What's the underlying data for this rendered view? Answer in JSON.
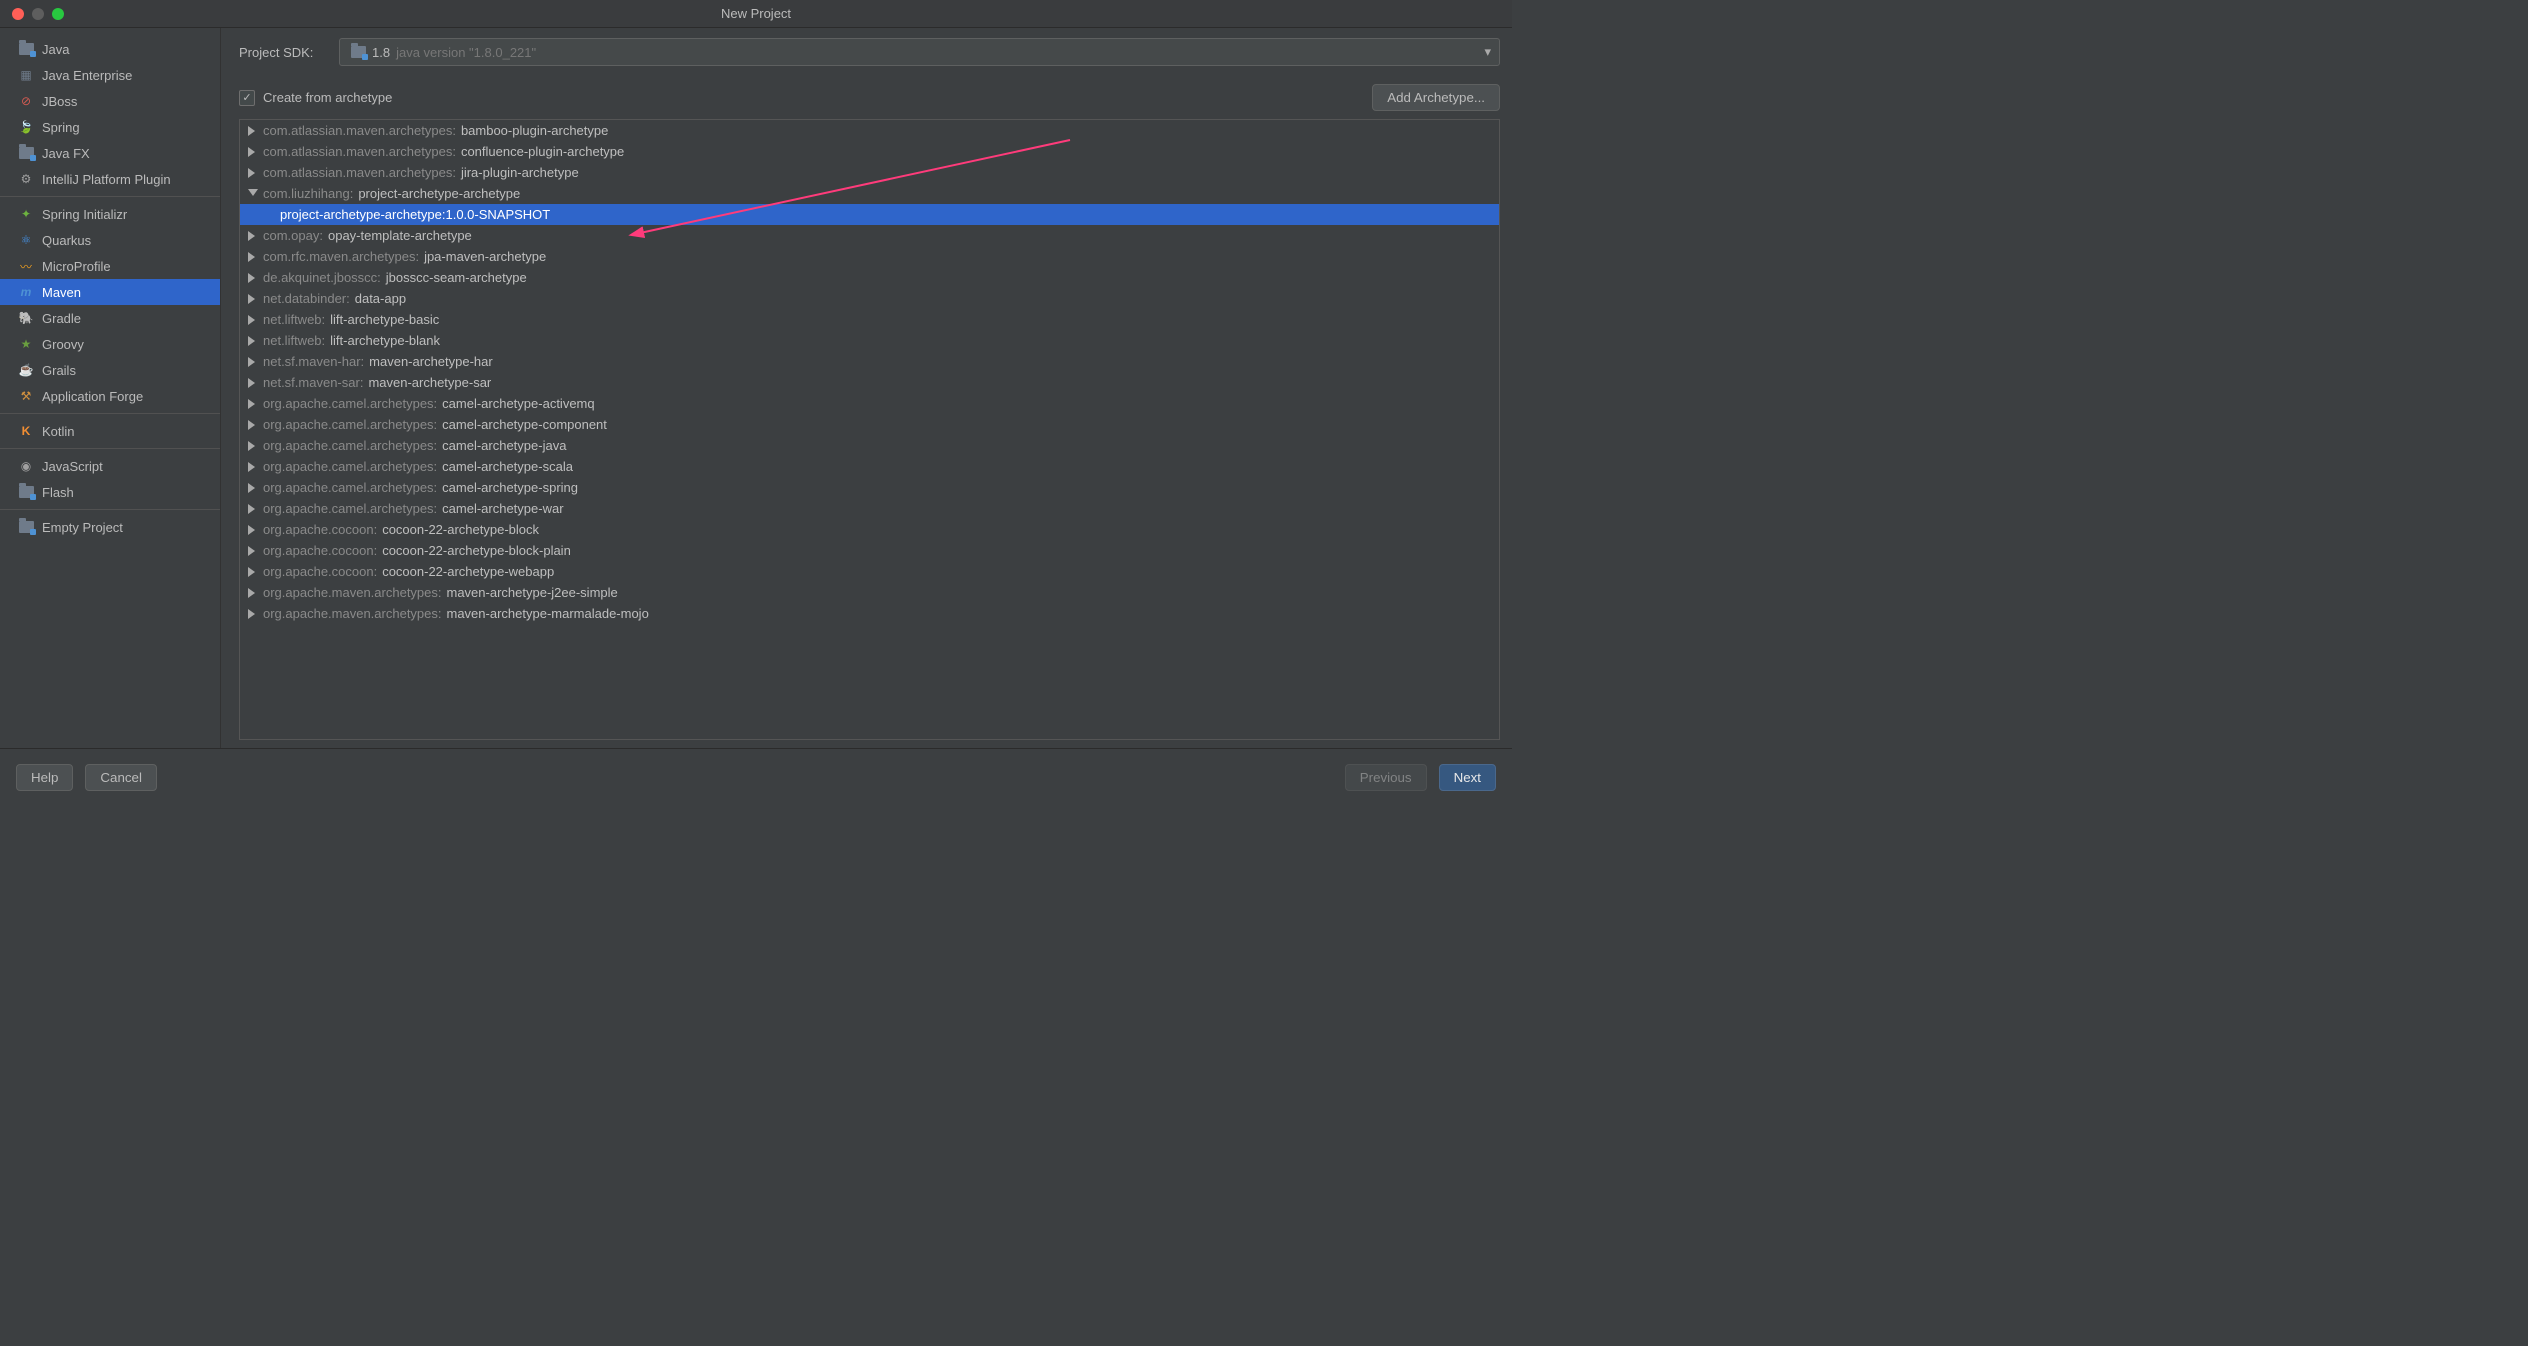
{
  "window": {
    "title": "New Project"
  },
  "sidebar": {
    "items": [
      {
        "label": "Java",
        "icon": "folder",
        "color": "#6f7b8a"
      },
      {
        "label": "Java Enterprise",
        "icon": "grid",
        "color": "#6f7b8a"
      },
      {
        "label": "JBoss",
        "icon": "circle-slash",
        "color": "#d45b52"
      },
      {
        "label": "Spring",
        "icon": "leaf",
        "color": "#6db33f"
      },
      {
        "label": "Java FX",
        "icon": "folder",
        "color": "#6f7b8a"
      },
      {
        "label": "IntelliJ Platform Plugin",
        "icon": "plug",
        "color": "#a0a0a0"
      },
      {
        "sep": true
      },
      {
        "label": "Spring Initializr",
        "icon": "spark",
        "color": "#6db33f"
      },
      {
        "label": "Quarkus",
        "icon": "atom",
        "color": "#4695eb"
      },
      {
        "label": "MicroProfile",
        "icon": "waves",
        "color": "#f0a020"
      },
      {
        "label": "Maven",
        "icon": "m",
        "color": "#4e92d4",
        "selected": true
      },
      {
        "label": "Gradle",
        "icon": "elephant",
        "color": "#7a8a8d"
      },
      {
        "label": "Groovy",
        "icon": "star",
        "color": "#6a9f3f"
      },
      {
        "label": "Grails",
        "icon": "cup",
        "color": "#d4923f"
      },
      {
        "label": "Application Forge",
        "icon": "anvil",
        "color": "#d4923f"
      },
      {
        "sep": true
      },
      {
        "label": "Kotlin",
        "icon": "k",
        "color": "#f18e33"
      },
      {
        "sep": true
      },
      {
        "label": "JavaScript",
        "icon": "js",
        "color": "#a0a0a0"
      },
      {
        "label": "Flash",
        "icon": "folder",
        "color": "#6f7b8a"
      },
      {
        "sep": true
      },
      {
        "label": "Empty Project",
        "icon": "folder",
        "color": "#6f7b8a"
      }
    ]
  },
  "main": {
    "sdk_label": "Project SDK:",
    "sdk_version": "1.8",
    "sdk_detail": "java version \"1.8.0_221\"",
    "checkbox_label": "Create from archetype",
    "checkbox_checked": true,
    "add_archetype_btn": "Add Archetype..."
  },
  "archetypes": [
    {
      "group": "com.atlassian.maven.archetypes",
      "name": "bamboo-plugin-archetype"
    },
    {
      "group": "com.atlassian.maven.archetypes",
      "name": "confluence-plugin-archetype"
    },
    {
      "group": "com.atlassian.maven.archetypes",
      "name": "jira-plugin-archetype"
    },
    {
      "group": "com.liuzhihang",
      "name": "project-archetype-archetype",
      "expanded": true,
      "children": [
        {
          "label": "project-archetype-archetype:1.0.0-SNAPSHOT",
          "selected": true
        }
      ]
    },
    {
      "group": "com.opay",
      "name": "opay-template-archetype"
    },
    {
      "group": "com.rfc.maven.archetypes",
      "name": "jpa-maven-archetype"
    },
    {
      "group": "de.akquinet.jbosscc",
      "name": "jbosscc-seam-archetype"
    },
    {
      "group": "net.databinder",
      "name": "data-app"
    },
    {
      "group": "net.liftweb",
      "name": "lift-archetype-basic"
    },
    {
      "group": "net.liftweb",
      "name": "lift-archetype-blank"
    },
    {
      "group": "net.sf.maven-har",
      "name": "maven-archetype-har"
    },
    {
      "group": "net.sf.maven-sar",
      "name": "maven-archetype-sar"
    },
    {
      "group": "org.apache.camel.archetypes",
      "name": "camel-archetype-activemq"
    },
    {
      "group": "org.apache.camel.archetypes",
      "name": "camel-archetype-component"
    },
    {
      "group": "org.apache.camel.archetypes",
      "name": "camel-archetype-java"
    },
    {
      "group": "org.apache.camel.archetypes",
      "name": "camel-archetype-scala"
    },
    {
      "group": "org.apache.camel.archetypes",
      "name": "camel-archetype-spring"
    },
    {
      "group": "org.apache.camel.archetypes",
      "name": "camel-archetype-war"
    },
    {
      "group": "org.apache.cocoon",
      "name": "cocoon-22-archetype-block"
    },
    {
      "group": "org.apache.cocoon",
      "name": "cocoon-22-archetype-block-plain"
    },
    {
      "group": "org.apache.cocoon",
      "name": "cocoon-22-archetype-webapp"
    },
    {
      "group": "org.apache.maven.archetypes",
      "name": "maven-archetype-j2ee-simple"
    },
    {
      "group": "org.apache.maven.archetypes",
      "name": "maven-archetype-marmalade-mojo"
    }
  ],
  "footer": {
    "help": "Help",
    "cancel": "Cancel",
    "previous": "Previous",
    "next": "Next"
  },
  "colors": {
    "selection": "#2f65ca",
    "annotation": "#ff3b7b"
  }
}
